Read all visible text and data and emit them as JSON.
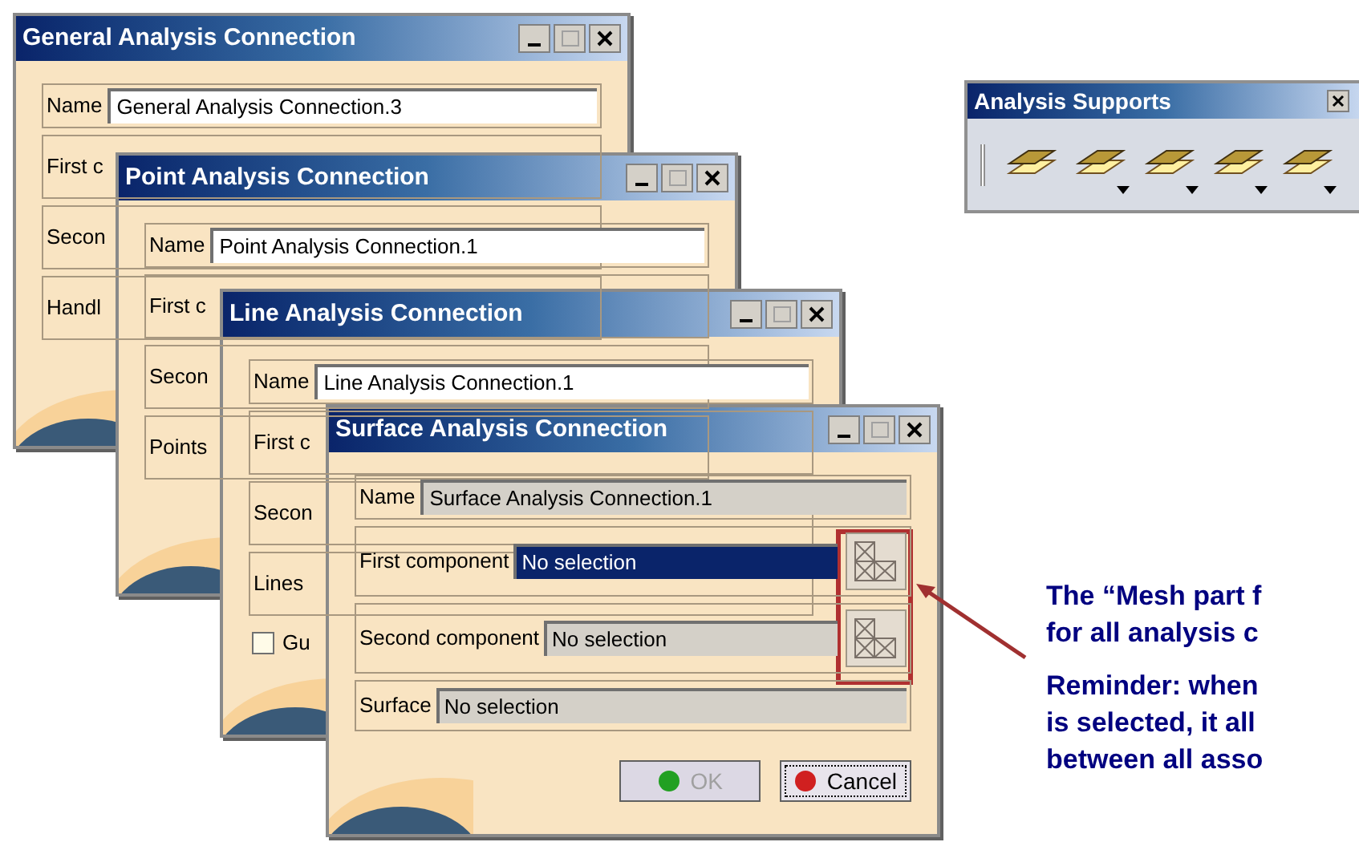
{
  "windows": [
    {
      "title": "General Analysis Connection",
      "rows": [
        {
          "kind": "field",
          "label": "Name",
          "value": "General Analysis Connection.3",
          "disabled": false
        },
        {
          "kind": "label",
          "label": "First c"
        },
        {
          "kind": "label",
          "label": "Secon"
        },
        {
          "kind": "label",
          "label": "Handl"
        }
      ]
    },
    {
      "title": "Point Analysis Connection",
      "rows": [
        {
          "kind": "field",
          "label": "Name",
          "value": "Point Analysis Connection.1",
          "disabled": false
        },
        {
          "kind": "label",
          "label": "First c"
        },
        {
          "kind": "label",
          "label": "Secon"
        },
        {
          "kind": "label",
          "label": "Points"
        }
      ]
    },
    {
      "title": "Line Analysis Connection",
      "rows": [
        {
          "kind": "field",
          "label": "Name",
          "value": "Line Analysis Connection.1",
          "disabled": false
        },
        {
          "kind": "label",
          "label": "First c"
        },
        {
          "kind": "label",
          "label": "Secon"
        },
        {
          "kind": "label",
          "label": "Lines"
        },
        {
          "kind": "checkbox",
          "label": "Gu",
          "checked": false
        }
      ]
    },
    {
      "title": "Surface Analysis Connection",
      "rows": [
        {
          "kind": "field",
          "label": "Name",
          "value": "Surface Analysis Connection.1",
          "disabled": true
        },
        {
          "kind": "selection",
          "label": "First component",
          "value": "No selection",
          "selected": true
        },
        {
          "kind": "selection",
          "label": "Second component",
          "value": "No selection",
          "selected": false
        },
        {
          "kind": "surface",
          "label": "Surface",
          "value": "No selection",
          "selected": false
        }
      ],
      "buttons": [
        {
          "label": "OK",
          "kind": "ok",
          "disabled": true
        },
        {
          "label": "Cancel",
          "kind": "cancel",
          "disabled": false
        }
      ]
    }
  ],
  "toolbar": {
    "title": "Analysis Supports",
    "tools": [
      {
        "dropdown": false
      },
      {
        "dropdown": true
      },
      {
        "dropdown": true
      },
      {
        "dropdown": true
      },
      {
        "dropdown": true
      }
    ]
  },
  "notes": [
    "The “Mesh part f\nfor all analysis c",
    "Reminder: when\nis selected, it all\nbetween all asso"
  ]
}
